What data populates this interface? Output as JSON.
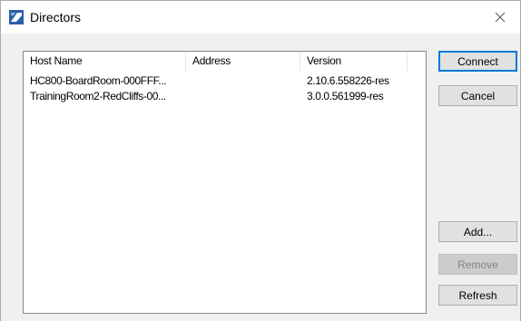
{
  "window": {
    "title": "Directors",
    "close_glyph": "✕"
  },
  "listview": {
    "columns": [
      "Host Name",
      "Address",
      "Version"
    ],
    "rows": [
      {
        "host": "HC800-BoardRoom-000FFF...",
        "address": "",
        "version": "2.10.6.558226-res"
      },
      {
        "host": "TrainingRoom2-RedCliffs-00...",
        "address": "",
        "version": "3.0.0.561999-res"
      }
    ]
  },
  "buttons": {
    "connect": "Connect",
    "cancel": "Cancel",
    "add": "Add...",
    "remove": "Remove",
    "refresh": "Refresh"
  },
  "colors": {
    "default_button_border": "#0078d7",
    "app_icon": "#1f4e8c"
  },
  "icons": {
    "app": "director-app-icon",
    "close": "close-icon"
  }
}
